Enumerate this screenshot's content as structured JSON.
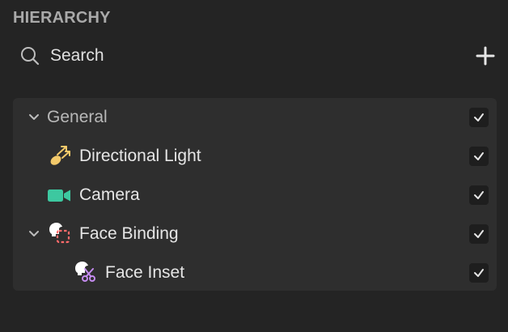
{
  "panel": {
    "title": "HIERARCHY"
  },
  "search": {
    "placeholder": "Search",
    "value": ""
  },
  "tree": {
    "group": {
      "label": "General",
      "expanded": true,
      "visible": true
    },
    "items": [
      {
        "label": "Directional Light",
        "icon": "directional-light-icon",
        "visible": true
      },
      {
        "label": "Camera",
        "icon": "camera-icon",
        "visible": true
      },
      {
        "label": "Face Binding",
        "icon": "face-binding-icon",
        "expanded": true,
        "visible": true
      },
      {
        "label": "Face Inset",
        "icon": "face-inset-icon",
        "visible": true
      }
    ]
  },
  "colors": {
    "background": "#242424",
    "tree_background": "#2e2e2e",
    "camera": "#3dc8a0",
    "light": "#f3c96a",
    "face_binding_accent": "#ff6b6b",
    "face_inset_accent": "#c58cf0"
  }
}
